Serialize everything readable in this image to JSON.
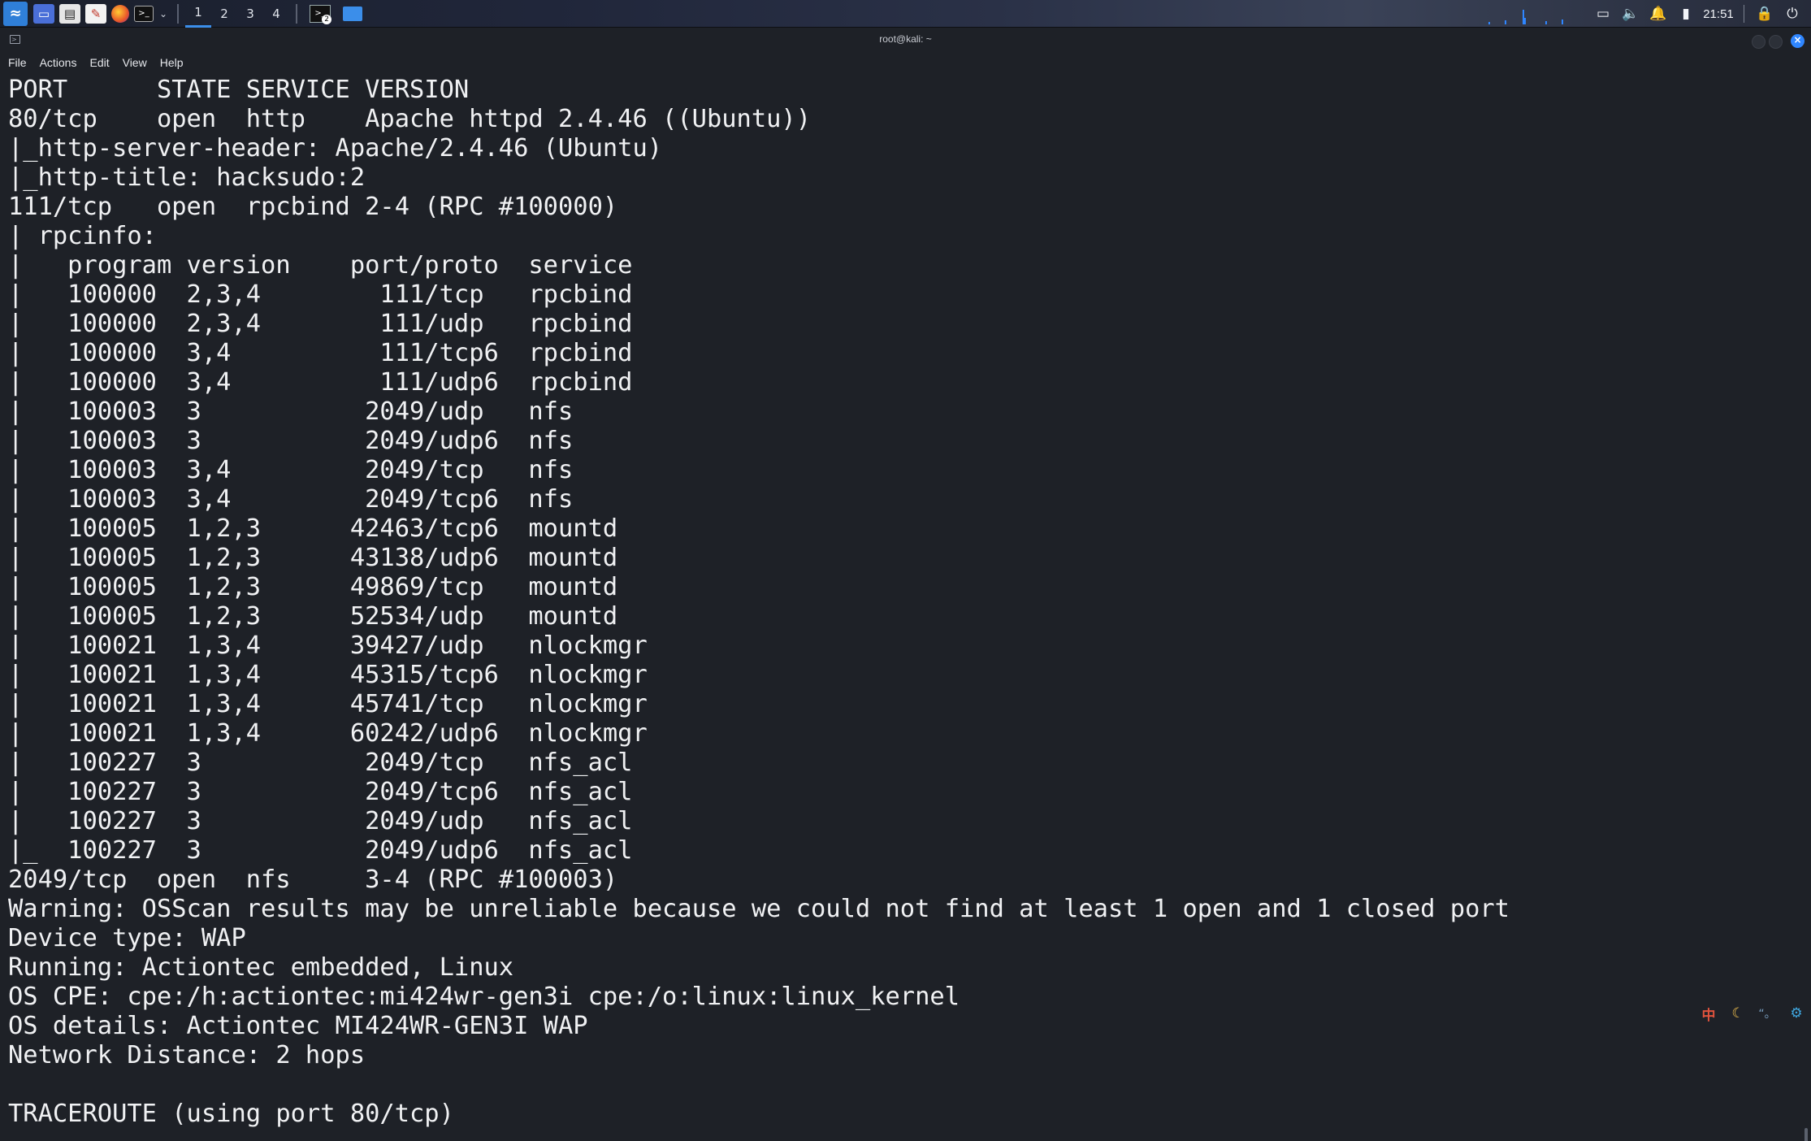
{
  "panel": {
    "launcher_icon": "kali-dragon-icon",
    "workspaces": [
      "1",
      "2",
      "3",
      "4"
    ],
    "active_workspace": "1",
    "terminal_task_count": "2",
    "clock": "21:51",
    "colors": {
      "accent": "#3b8eea",
      "panel_bg": "#20263a"
    }
  },
  "window": {
    "title": "root@kali: ~",
    "close_glyph": "×"
  },
  "menu": {
    "file": "File",
    "actions": "Actions",
    "edit": "Edit",
    "view": "View",
    "help": "Help"
  },
  "terminal": {
    "lines": [
      "PORT      STATE SERVICE VERSION",
      "80/tcp    open  http    Apache httpd 2.4.46 ((Ubuntu))",
      "|_http-server-header: Apache/2.4.46 (Ubuntu)",
      "|_http-title: hacksudo:2",
      "111/tcp   open  rpcbind 2-4 (RPC #100000)",
      "| rpcinfo:",
      "|   program version    port/proto  service",
      "|   100000  2,3,4        111/tcp   rpcbind",
      "|   100000  2,3,4        111/udp   rpcbind",
      "|   100000  3,4          111/tcp6  rpcbind",
      "|   100000  3,4          111/udp6  rpcbind",
      "|   100003  3           2049/udp   nfs",
      "|   100003  3           2049/udp6  nfs",
      "|   100003  3,4         2049/tcp   nfs",
      "|   100003  3,4         2049/tcp6  nfs",
      "|   100005  1,2,3      42463/tcp6  mountd",
      "|   100005  1,2,3      43138/udp6  mountd",
      "|   100005  1,2,3      49869/tcp   mountd",
      "|   100005  1,2,3      52534/udp   mountd",
      "|   100021  1,3,4      39427/udp   nlockmgr",
      "|   100021  1,3,4      45315/tcp6  nlockmgr",
      "|   100021  1,3,4      45741/tcp   nlockmgr",
      "|   100021  1,3,4      60242/udp6  nlockmgr",
      "|   100227  3           2049/tcp   nfs_acl",
      "|   100227  3           2049/tcp6  nfs_acl",
      "|   100227  3           2049/udp   nfs_acl",
      "|_  100227  3           2049/udp6  nfs_acl",
      "2049/tcp  open  nfs     3-4 (RPC #100003)",
      "Warning: OSScan results may be unreliable because we could not find at least 1 open and 1 closed port",
      "Device type: WAP",
      "Running: Actiontec embedded, Linux",
      "OS CPE: cpe:/h:actiontec:mi424wr-gen3i cpe:/o:linux:linux_kernel",
      "OS details: Actiontec MI424WR-GEN3I WAP",
      "Network Distance: 2 hops",
      "",
      "TRACEROUTE (using port 80/tcp)"
    ]
  },
  "ime": {
    "lang": "中",
    "mode_icon": "moon-icon",
    "punct": "“。",
    "settings_icon": "gear-icon"
  }
}
